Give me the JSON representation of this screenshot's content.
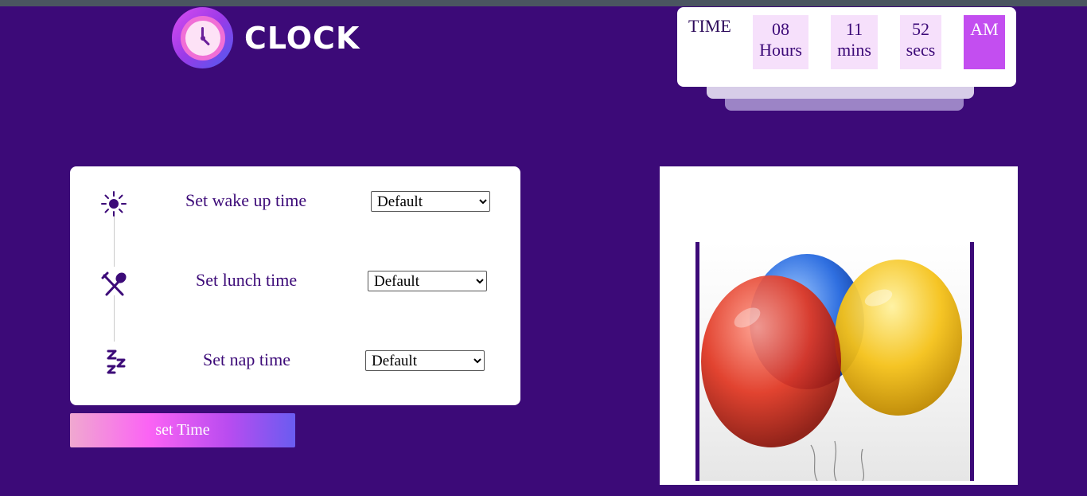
{
  "app": {
    "logo_text": "CLOCK"
  },
  "clock": {
    "time_label": "TIME",
    "hours_value": "08",
    "hours_unit": "Hours",
    "mins_value": "11",
    "mins_unit": "mins",
    "secs_value": "52",
    "secs_unit": "secs",
    "ampm": "AM"
  },
  "settings": {
    "rows": [
      {
        "label": "Set wake up time",
        "selected": "Default",
        "icon": "sun-icon"
      },
      {
        "label": "Set lunch time",
        "selected": "Default",
        "icon": "fork-spoon-icon"
      },
      {
        "label": "Set nap time",
        "selected": "Default",
        "icon": "zzz-icon"
      }
    ]
  },
  "button": {
    "label": "set Time"
  },
  "colors": {
    "background": "#3c0a78",
    "accent": "#c34ef0",
    "text": "#3c0a78"
  }
}
